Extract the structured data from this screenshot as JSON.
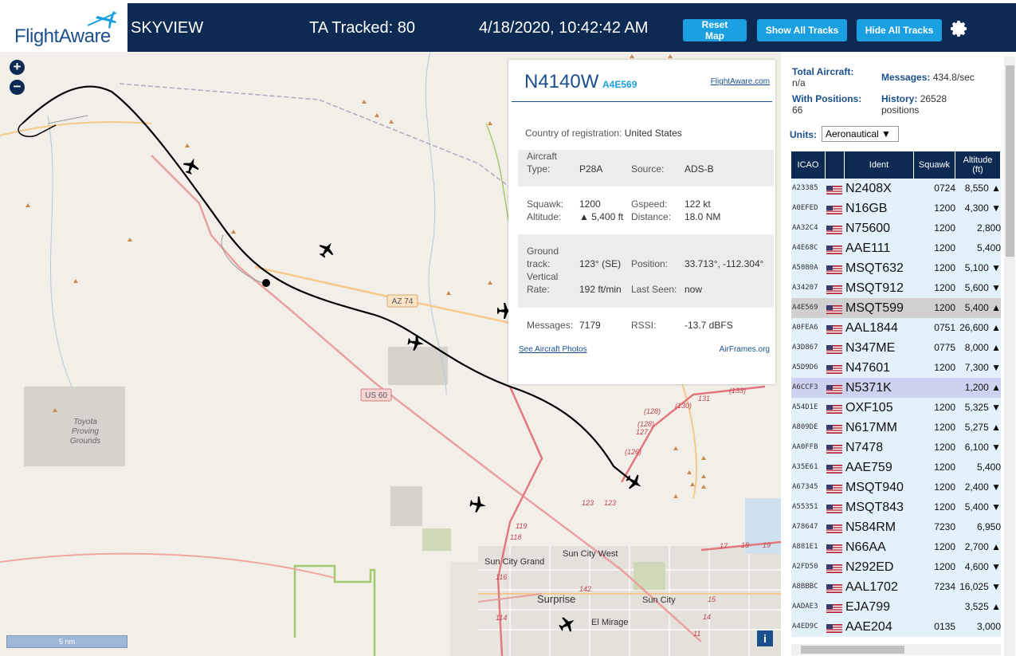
{
  "header": {
    "logo_text": "FlightAware",
    "app_name": "SKYVIEW",
    "tracked": "TA Tracked: 80",
    "datetime": "4/18/2020, 10:42:42 AM",
    "buttons": {
      "reset": "Reset Map",
      "show": "Show All Tracks",
      "hide": "Hide All Tracks"
    }
  },
  "map": {
    "zoom_in": "+",
    "zoom_out": "−",
    "scale": "5 nm",
    "info": "i",
    "labels": {
      "az74": "AZ 74",
      "us60": "US 60",
      "toyota1": "Toyota",
      "toyota2": "Proving",
      "toyota3": "Grounds",
      "sun_city_west": "Sun City West",
      "sun_city_grand": "Sun City Grand",
      "surprise": "Surprise",
      "sun_city": "Sun City",
      "el_mirage": "El Mirage",
      "r131": "131",
      "r133": "(133)",
      "r130": "(130)",
      "r128": "(128)",
      "r128b": "(128)",
      "r127": "127",
      "r126": "(126)",
      "r123": "123",
      "r123b": "123",
      "r119": "119",
      "r118": "118",
      "r116": "116",
      "r114": "114",
      "r142": "142",
      "r17": "17",
      "r18": "18",
      "r19": "19",
      "r15": "15",
      "r14": "14",
      "r11": "11"
    }
  },
  "popup": {
    "ident": "N4140W",
    "hex": "A4E569",
    "fa_link": "FlightAware.com",
    "country_label": "Country of registration:",
    "country": "United States",
    "aircraft_type_label1": "Aircraft",
    "aircraft_type_label2": "Type:",
    "aircraft_type": "P28A",
    "source_label": "Source:",
    "source": "ADS-B",
    "squawk_label": "Squawk:",
    "squawk": "1200",
    "altitude_label": "Altitude:",
    "altitude": "▲ 5,400 ft",
    "gspeed_label": "Gspeed:",
    "gspeed": "122 kt",
    "distance_label": "Distance:",
    "distance": "18.0 NM",
    "track_label1": "Ground",
    "track_label2": "track:",
    "track": "123° (SE)",
    "position_label": "Position:",
    "position": "33.713°, -112.304°",
    "vrate_label1": "Vertical",
    "vrate_label2": "Rate:",
    "vrate": "192 ft/min",
    "last_seen_label": "Last Seen:",
    "last_seen": "now",
    "messages_label": "Messages:",
    "messages": "7179",
    "rssi_label": "RSSI:",
    "rssi": "-13.7 dBFS",
    "photos_link": "See Aircraft Photos",
    "airframes_link": "AirFrames.org"
  },
  "panel": {
    "total_label": "Total Aircraft:",
    "total": "n/a",
    "messages_label": "Messages:",
    "messages": "434.8/sec",
    "with_pos_label": "With Positions:",
    "with_pos": "66",
    "history_label": "History:",
    "history_value": "26528",
    "history_unit": "positions",
    "units_label": "Units:",
    "units_value": "Aeronautical ▼"
  },
  "table": {
    "headers": {
      "icao": "ICAO",
      "ident": "Ident",
      "squawk": "Squawk",
      "alt1": "Altitude",
      "alt2": "(ft)"
    },
    "rows": [
      {
        "icao": "A23385",
        "ident": "N2408X",
        "squawk": "0724",
        "alt": "8,550 ▲"
      },
      {
        "icao": "A0EFED",
        "ident": "N16GB",
        "squawk": "1200",
        "alt": "4,300 ▼"
      },
      {
        "icao": "AA32C4",
        "ident": "N75600",
        "squawk": "1200",
        "alt": "2,800"
      },
      {
        "icao": "A4E68C",
        "ident": "AAE111",
        "squawk": "1200",
        "alt": "5,400"
      },
      {
        "icao": "A5080A",
        "ident": "MSQT632",
        "squawk": "1200",
        "alt": "5,100 ▼"
      },
      {
        "icao": "A34207",
        "ident": "MSQT912",
        "squawk": "1200",
        "alt": "5,600 ▼"
      },
      {
        "icao": "A4E569",
        "ident": "MSQT599",
        "squawk": "1200",
        "alt": "5,400 ▲"
      },
      {
        "icao": "A0FEA6",
        "ident": "AAL1844",
        "squawk": "0751",
        "alt": "26,600 ▲"
      },
      {
        "icao": "A3D867",
        "ident": "N347ME",
        "squawk": "0775",
        "alt": "8,000 ▲"
      },
      {
        "icao": "A5D9D6",
        "ident": "N47601",
        "squawk": "1200",
        "alt": "7,300 ▼"
      },
      {
        "icao": "A6CCF3",
        "ident": "N5371K",
        "squawk": "",
        "alt": "1,200 ▲"
      },
      {
        "icao": "A54D1E",
        "ident": "OXF105",
        "squawk": "1200",
        "alt": "5,325 ▼"
      },
      {
        "icao": "A809DE",
        "ident": "N617MM",
        "squawk": "1200",
        "alt": "5,275 ▲"
      },
      {
        "icao": "AA0FFB",
        "ident": "N7478",
        "squawk": "1200",
        "alt": "6,100 ▼"
      },
      {
        "icao": "A35E61",
        "ident": "AAE759",
        "squawk": "1200",
        "alt": "5,400"
      },
      {
        "icao": "A67345",
        "ident": "MSQT940",
        "squawk": "1200",
        "alt": "2,400 ▼"
      },
      {
        "icao": "A55351",
        "ident": "MSQT843",
        "squawk": "1200",
        "alt": "5,400 ▼"
      },
      {
        "icao": "A78647",
        "ident": "N584RM",
        "squawk": "7230",
        "alt": "6,950"
      },
      {
        "icao": "A881E1",
        "ident": "N66AA",
        "squawk": "1200",
        "alt": "2,700 ▲"
      },
      {
        "icao": "A2FD50",
        "ident": "N292ED",
        "squawk": "1200",
        "alt": "4,600 ▼"
      },
      {
        "icao": "A8BBBC",
        "ident": "AAL1702",
        "squawk": "7234",
        "alt": "16,025 ▼"
      },
      {
        "icao": "AADAE3",
        "ident": "EJA799",
        "squawk": "",
        "alt": "3,525 ▲"
      },
      {
        "icao": "A4ED9C",
        "ident": "AAE204",
        "squawk": "0135",
        "alt": "3,000"
      }
    ]
  },
  "colors": {
    "header_bg": "#0d2a52",
    "button_bg": "#1aa0e0",
    "brand_blue": "#1b4f8c",
    "row_selected": "#d0d0d0",
    "row_highlight": "#cdd2f0",
    "row_bg": "#e3f1fb"
  }
}
